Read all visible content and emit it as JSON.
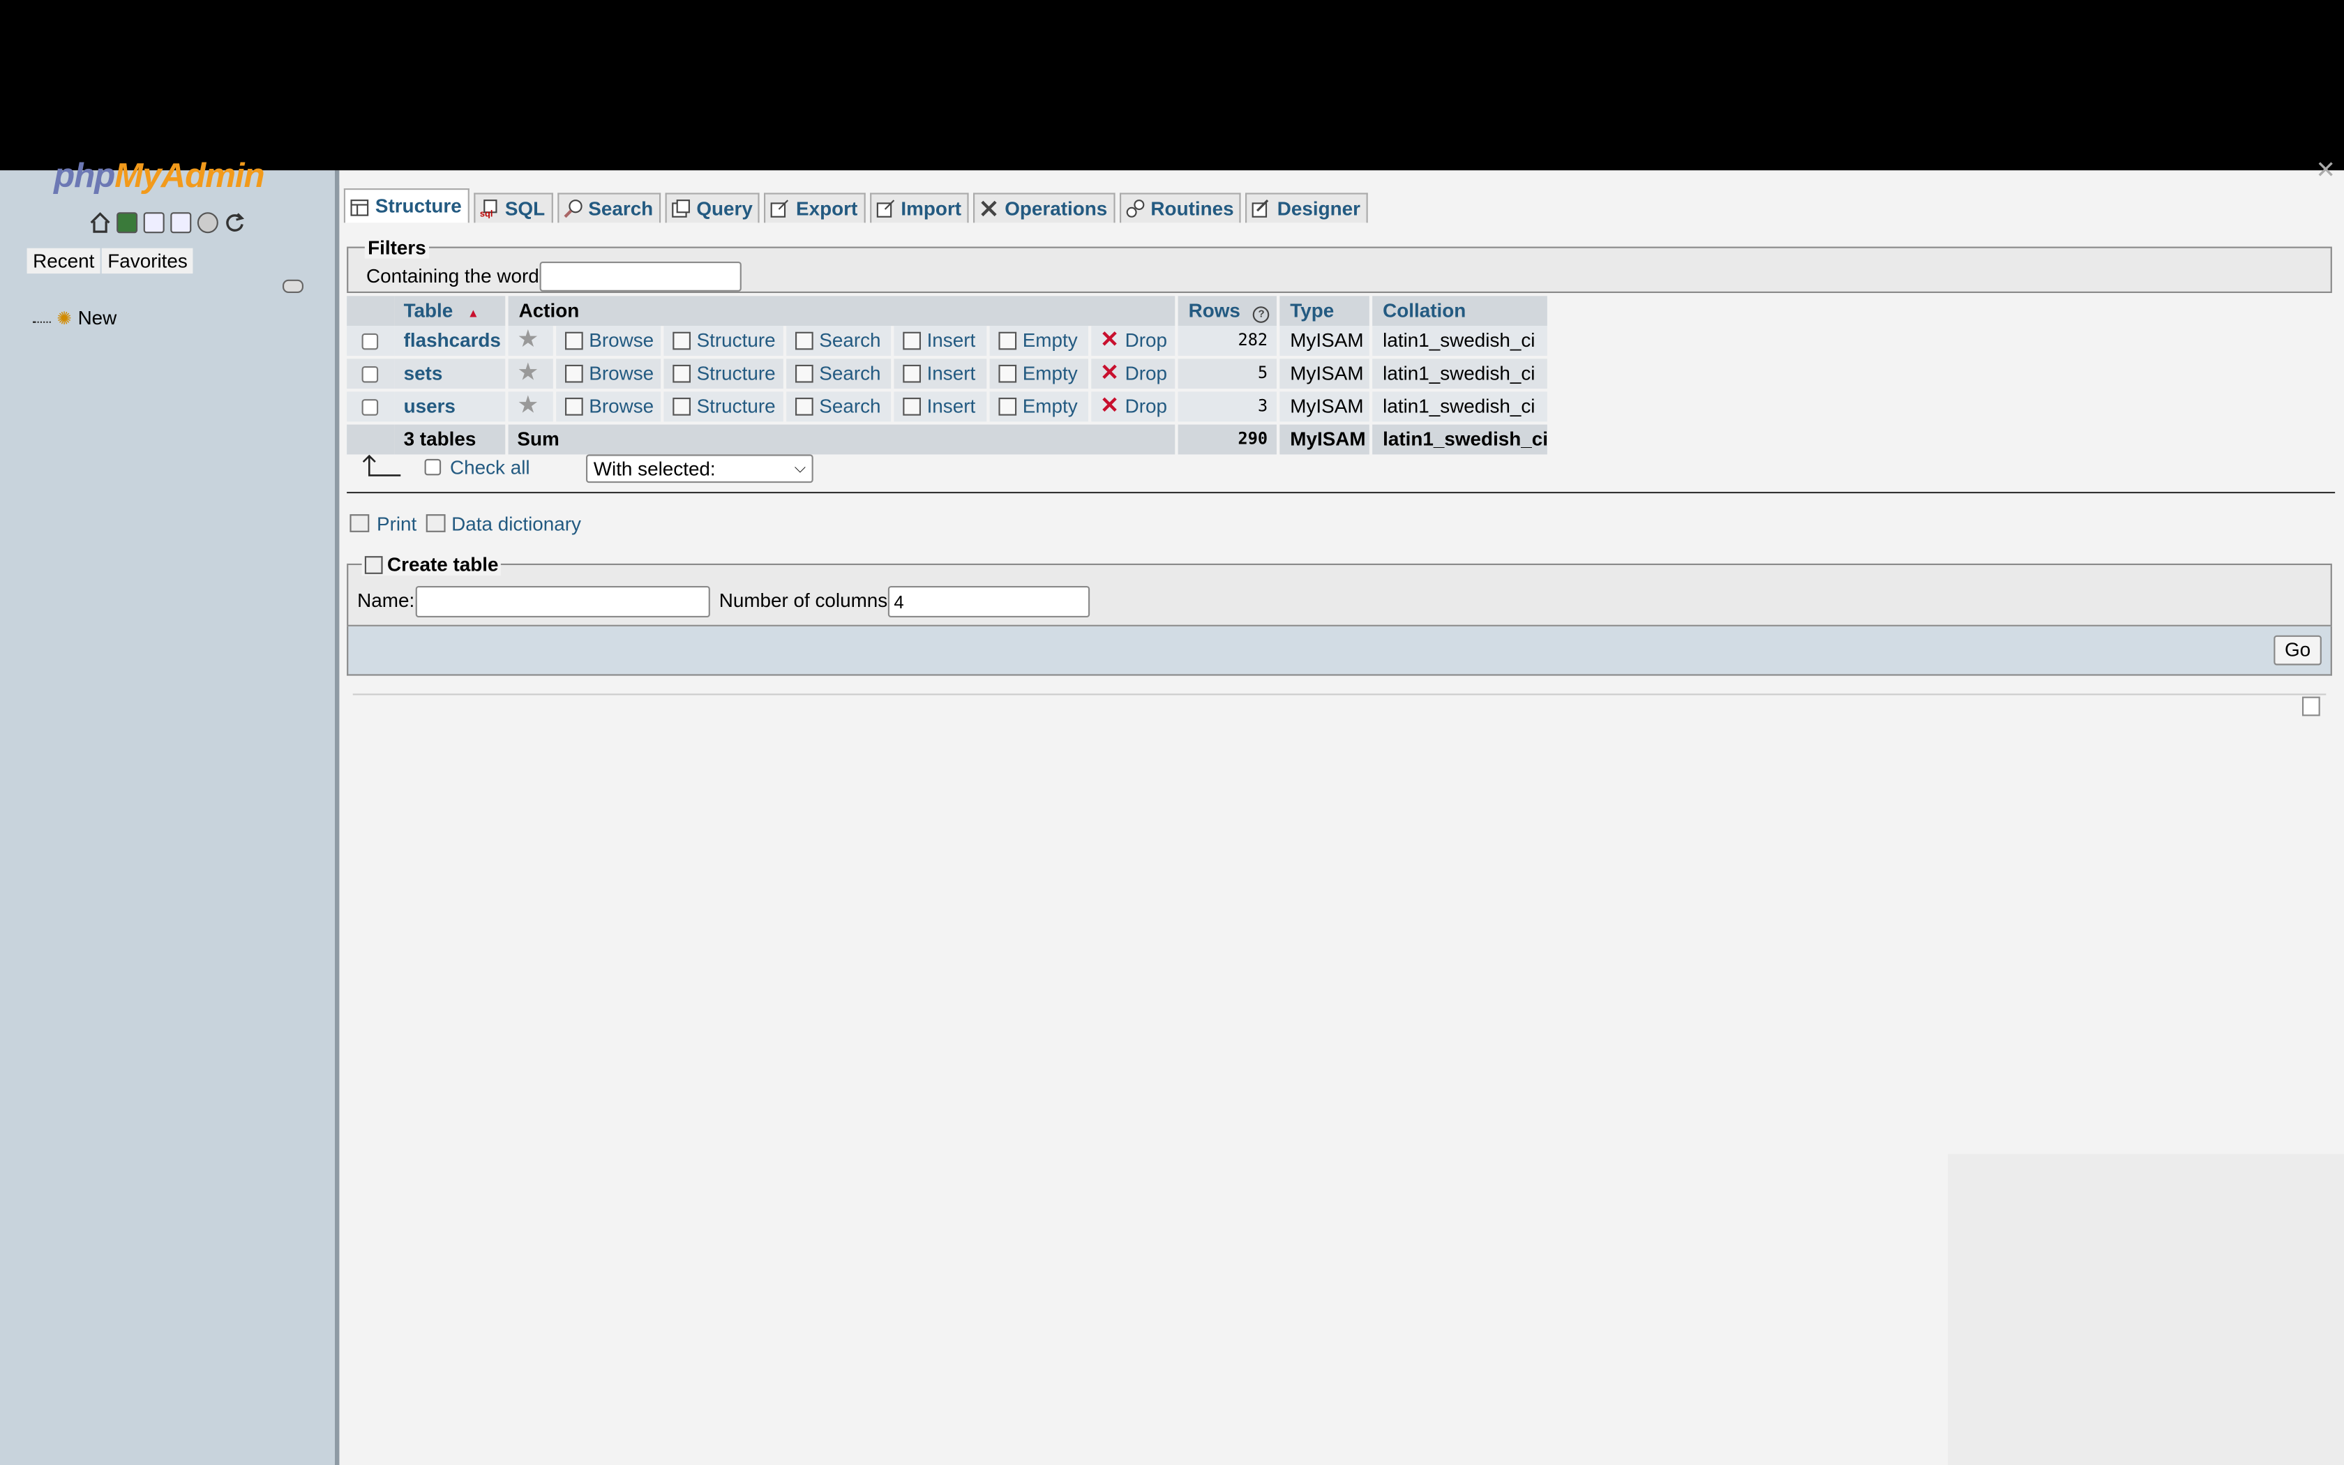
{
  "nav": {
    "logo_php": "php",
    "logo_my": "MyAdmin",
    "tab_recent": "Recent",
    "tab_favorites": "Favorites",
    "new_label": "New"
  },
  "tabs": [
    {
      "label": "Structure",
      "icon": "structure-icon",
      "active": true
    },
    {
      "label": "SQL",
      "icon": "sql-icon"
    },
    {
      "label": "Search",
      "icon": "search-icon"
    },
    {
      "label": "Query",
      "icon": "query-icon"
    },
    {
      "label": "Export",
      "icon": "export-icon"
    },
    {
      "label": "Import",
      "icon": "import-icon"
    },
    {
      "label": "Operations",
      "icon": "operations-icon"
    },
    {
      "label": "Routines",
      "icon": "routines-icon"
    },
    {
      "label": "Designer",
      "icon": "designer-icon"
    }
  ],
  "filters": {
    "legend": "Filters",
    "label": "Containing the word:",
    "value": ""
  },
  "table": {
    "headers": {
      "table": "Table",
      "sort_indicator": "▲",
      "action": "Action",
      "rows": "Rows",
      "type": "Type",
      "collation": "Collation"
    },
    "actions": {
      "browse": "Browse",
      "structure": "Structure",
      "search": "Search",
      "insert": "Insert",
      "empty": "Empty",
      "drop": "Drop"
    },
    "rows": [
      {
        "name": "flashcards",
        "rows": "282",
        "type": "MyISAM",
        "collation": "latin1_swedish_ci"
      },
      {
        "name": "sets",
        "rows": "5",
        "type": "MyISAM",
        "collation": "latin1_swedish_ci"
      },
      {
        "name": "users",
        "rows": "3",
        "type": "MyISAM",
        "collation": "latin1_swedish_ci"
      }
    ],
    "summary": {
      "count": "3 tables",
      "label": "Sum",
      "rows": "290",
      "type": "MyISAM",
      "collation": "latin1_swedish_ci"
    }
  },
  "bulk": {
    "check_all": "Check all",
    "with_selected": "With selected:"
  },
  "links": {
    "print": "Print",
    "data_dictionary": "Data dictionary"
  },
  "create_table": {
    "legend": "Create table",
    "name_label": "Name:",
    "name_value": "",
    "columns_label": "Number of columns:",
    "columns_value": "4",
    "go": "Go"
  }
}
